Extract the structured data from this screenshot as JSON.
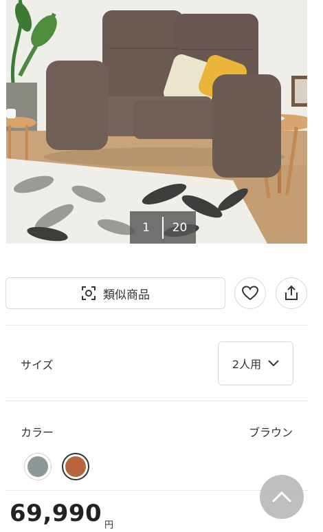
{
  "gallery": {
    "current": "1",
    "total": "20"
  },
  "actions": {
    "similar_label": "類似商品"
  },
  "options": {
    "size_label": "サイズ",
    "size_value": "2人用",
    "color_label": "カラー",
    "color_value": "ブラウン",
    "swatches": [
      {
        "name": "gray",
        "color": "#8e9698"
      },
      {
        "name": "brown",
        "color": "#b8653d"
      }
    ]
  },
  "price": {
    "amount": "69,990",
    "unit": "円"
  },
  "icons": {
    "similar": "scan-icon",
    "favorite": "heart-icon",
    "share": "share-icon",
    "dropdown": "chevron-down-icon",
    "scroll_top": "chevron-up-icon"
  }
}
